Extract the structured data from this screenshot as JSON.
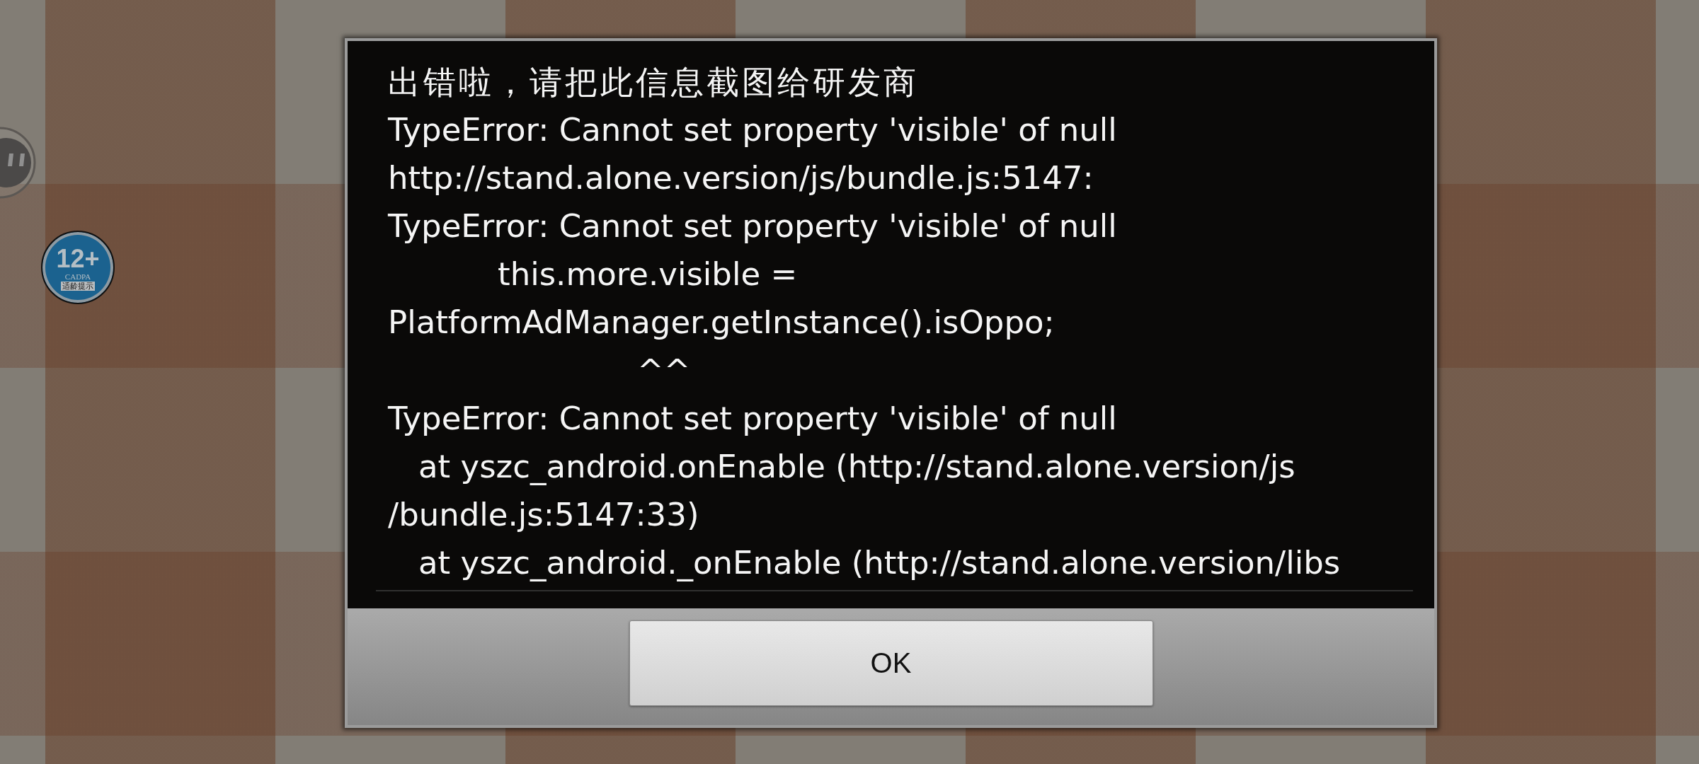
{
  "age_badge": {
    "rating": "12+",
    "org": "CADPA",
    "label": "适龄提示"
  },
  "error_dialog": {
    "lines": [
      {
        "kind": "title",
        "text": "出错啦，请把此信息截图给研发商"
      },
      {
        "kind": "plain",
        "text": "TypeError: Cannot set property 'visible' of null"
      },
      {
        "kind": "plain",
        "text": "http://stand.alone.version/js/bundle.js:5147:"
      },
      {
        "kind": "plain",
        "text": "TypeError: Cannot set property 'visible' of null"
      },
      {
        "kind": "source",
        "text": "this.more.visible ="
      },
      {
        "kind": "plain",
        "text": "PlatformAdManager.getInstance().isOppo;"
      },
      {
        "kind": "pointer",
        "text": "^^"
      },
      {
        "kind": "plain",
        "text": "TypeError: Cannot set property 'visible' of null"
      },
      {
        "kind": "frame",
        "text": "at yszc_android.onEnable (http://stand.alone.version/js"
      },
      {
        "kind": "plain",
        "text": "/bundle.js:5147:33)"
      },
      {
        "kind": "frame",
        "text": "at yszc_android._onEnable (http://stand.alone.version/libs"
      }
    ],
    "button": "OK"
  }
}
